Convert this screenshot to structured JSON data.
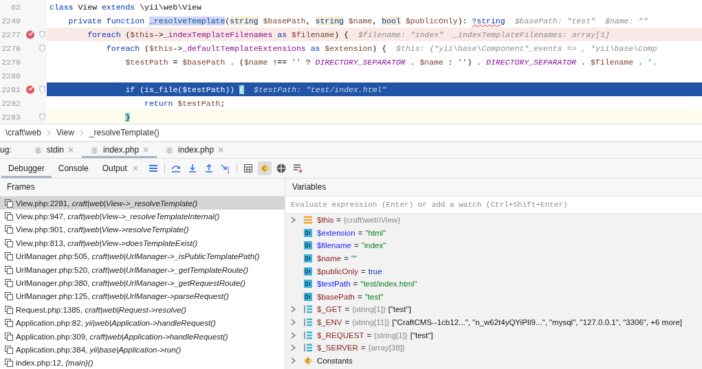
{
  "editor": {
    "lines": [
      {
        "number": "62",
        "kind": "normal",
        "breakpoint": false,
        "fold": false,
        "tokens": [
          {
            "kind": "kw",
            "text": "class"
          },
          {
            "kind": "plain",
            "text": " View "
          },
          {
            "kind": "kw",
            "text": "extends"
          },
          {
            "kind": "plain",
            "text": " \\yii\\web\\View"
          }
        ]
      },
      {
        "number": "2249",
        "kind": "normal",
        "breakpoint": false,
        "fold": false,
        "tokens": [
          {
            "kind": "kw",
            "text": "    private function "
          },
          {
            "kind": "fnhl",
            "text": "_resolveTemplate"
          },
          {
            "kind": "plain",
            "text": "("
          },
          {
            "kind": "typehl",
            "text": "string"
          },
          {
            "kind": "var",
            "text": " $basePath"
          },
          {
            "kind": "plain",
            "text": ", "
          },
          {
            "kind": "typehl",
            "text": "string"
          },
          {
            "kind": "var",
            "text": " $name"
          },
          {
            "kind": "plain",
            "text": ", "
          },
          {
            "kind": "typehl",
            "text": "bool"
          },
          {
            "kind": "var",
            "text": " $publicOnly"
          },
          {
            "kind": "plain",
            "text": "): "
          },
          {
            "kind": "err",
            "text": "?string"
          }
        ],
        "hints": [
          "$basePath: \"test\"",
          "$name: \"\""
        ]
      },
      {
        "number": "2277",
        "kind": "breakpoint",
        "breakpoint": true,
        "fold": true,
        "tokens": [
          {
            "kind": "kw",
            "text": "        foreach"
          },
          {
            "kind": "plain",
            "text": " ("
          },
          {
            "kind": "var",
            "text": "$this"
          },
          {
            "kind": "plain",
            "text": "->"
          },
          {
            "kind": "field",
            "text": "_indexTemplateFilenames"
          },
          {
            "kind": "kw",
            "text": " as "
          },
          {
            "kind": "var",
            "text": "$filename"
          },
          {
            "kind": "plain",
            "text": ") {"
          }
        ],
        "hints": [
          "$filename: \"index\"",
          "_indexTemplateFilenames: array[1]"
        ]
      },
      {
        "number": "2278",
        "kind": "normal",
        "breakpoint": false,
        "fold": true,
        "tokens": [
          {
            "kind": "kw",
            "text": "            foreach"
          },
          {
            "kind": "plain",
            "text": " ("
          },
          {
            "kind": "var",
            "text": "$this"
          },
          {
            "kind": "plain",
            "text": "->"
          },
          {
            "kind": "field",
            "text": "_defaultTemplateExtensions"
          },
          {
            "kind": "kw",
            "text": " as "
          },
          {
            "kind": "var",
            "text": "$extension"
          },
          {
            "kind": "plain",
            "text": ") {"
          }
        ],
        "hints": [
          "$this: {*yii\\base\\Component*_events => , *yii\\base\\Comp"
        ]
      },
      {
        "number": "2279",
        "kind": "normal",
        "breakpoint": false,
        "fold": false,
        "tokens": [
          {
            "kind": "var",
            "text": "                $testPath"
          },
          {
            "kind": "plain",
            "text": " = "
          },
          {
            "kind": "var",
            "text": "$basePath"
          },
          {
            "kind": "plain",
            "text": " . ("
          },
          {
            "kind": "var",
            "text": "$name"
          },
          {
            "kind": "plain",
            "text": " !== "
          },
          {
            "kind": "str",
            "text": "''"
          },
          {
            "kind": "plain",
            "text": " ? "
          },
          {
            "kind": "const",
            "text": "DIRECTORY_SEPARATOR"
          },
          {
            "kind": "plain",
            "text": " . "
          },
          {
            "kind": "var",
            "text": "$name"
          },
          {
            "kind": "plain",
            "text": " : "
          },
          {
            "kind": "str",
            "text": "''"
          },
          {
            "kind": "plain",
            "text": ") . "
          },
          {
            "kind": "const",
            "text": "DIRECTORY_SEPARATOR"
          },
          {
            "kind": "plain",
            "text": " . "
          },
          {
            "kind": "var",
            "text": "$filename"
          },
          {
            "kind": "plain",
            "text": " . "
          },
          {
            "kind": "str",
            "text": "'."
          }
        ]
      },
      {
        "number": "2280",
        "kind": "normal",
        "breakpoint": false,
        "fold": false
      },
      {
        "number": "2281",
        "kind": "execution",
        "breakpoint": true,
        "fold": true,
        "tokens": [
          {
            "kind": "kw",
            "text": "                if"
          },
          {
            "kind": "plain",
            "text": " (is_file("
          },
          {
            "kind": "var",
            "text": "$testPath"
          },
          {
            "kind": "plain",
            "text": ")) "
          },
          {
            "kind": "brace",
            "text": "{"
          }
        ],
        "hints": [
          "$testPath: \"test/index.html\""
        ]
      },
      {
        "number": "2282",
        "kind": "normal",
        "breakpoint": false,
        "fold": false,
        "tokens": [
          {
            "kind": "kw",
            "text": "                    return"
          },
          {
            "kind": "var",
            "text": " $testPath"
          },
          {
            "kind": "plain",
            "text": ";"
          }
        ]
      },
      {
        "number": "2283",
        "kind": "caret",
        "breakpoint": false,
        "fold": true,
        "tokens": [
          {
            "kind": "brace",
            "text": "                }"
          }
        ]
      }
    ]
  },
  "breadcrumb": [
    "\\craft\\web",
    "View",
    "_resolveTemplate()"
  ],
  "debug_label": "ug:",
  "sessions": [
    {
      "label": "stdin",
      "selected": false
    },
    {
      "label": "index.php",
      "selected": true
    },
    {
      "label": "index.php",
      "selected": false
    }
  ],
  "subtabs": [
    {
      "label": "Debugger",
      "selected": true,
      "closable": false
    },
    {
      "label": "Console",
      "selected": false,
      "closable": false
    },
    {
      "label": "Output",
      "selected": false,
      "closable": true
    }
  ],
  "toolbar": [
    {
      "kind": "menu",
      "pressed": false
    },
    {
      "kind": "step-over",
      "pressed": false
    },
    {
      "kind": "step-into",
      "pressed": false
    },
    {
      "kind": "step-out",
      "pressed": false
    },
    {
      "kind": "run-to-cursor",
      "pressed": false
    },
    {
      "kind": "calculator",
      "pressed": false
    },
    {
      "kind": "constant",
      "pressed": true
    },
    {
      "kind": "globe",
      "pressed": false
    },
    {
      "kind": "add-list",
      "pressed": false
    }
  ],
  "frames": {
    "title": "Frames",
    "items": [
      {
        "location": "View.php:2281, ",
        "method": "craft|web|View->_resolveTemplate()",
        "selected": true
      },
      {
        "location": "View.php:947, ",
        "method": "craft|web|View->_resolveTemplateInternal()",
        "selected": false
      },
      {
        "location": "View.php:901, ",
        "method": "craft|web|View->resolveTemplate()",
        "selected": false
      },
      {
        "location": "View.php:813, ",
        "method": "craft|web|View->doesTemplateExist()",
        "selected": false
      },
      {
        "location": "UrlManager.php:505, ",
        "method": "craft|web|UrlManager->_isPublicTemplatePath()",
        "selected": false
      },
      {
        "location": "UrlManager.php:520, ",
        "method": "craft|web|UrlManager->_getTemplateRoute()",
        "selected": false
      },
      {
        "location": "UrlManager.php:380, ",
        "method": "craft|web|UrlManager->_getRequestRoute()",
        "selected": false
      },
      {
        "location": "UrlManager.php:125, ",
        "method": "craft|web|UrlManager->parseRequest()",
        "selected": false
      },
      {
        "location": "Request.php:1385, ",
        "method": "craft|web|Request->resolve()",
        "selected": false
      },
      {
        "location": "Application.php:82, ",
        "method": "yii|web|Application->handleRequest()",
        "selected": false
      },
      {
        "location": "Application.php:309, ",
        "method": "craft|web|Application->handleRequest()",
        "selected": false
      },
      {
        "location": "Application.php:384, ",
        "method": "yii|base|Application->run()",
        "selected": false
      },
      {
        "location": "index.php:12, ",
        "method": "{main}()",
        "selected": false
      }
    ]
  },
  "variables": {
    "title": "Variables",
    "placeholder": "Evaluate expression (Enter) or add a watch (Ctrl+Shift+Enter)",
    "items": [
      {
        "kind": "object",
        "expandable": true,
        "name": "$this",
        "changed": false,
        "operator": "=",
        "type": "{craft\\web\\View}"
      },
      {
        "kind": "scalar",
        "expandable": false,
        "name": "$extension",
        "changed": true,
        "operator": "=",
        "value": {
          "kind": "string",
          "text": "\"html\""
        }
      },
      {
        "kind": "scalar",
        "expandable": false,
        "name": "$filename",
        "changed": true,
        "operator": "=",
        "value": {
          "kind": "string",
          "text": "\"index\""
        }
      },
      {
        "kind": "scalar",
        "expandable": false,
        "name": "$name",
        "changed": false,
        "operator": "=",
        "value": {
          "kind": "string",
          "text": "\"\""
        }
      },
      {
        "kind": "scalar",
        "expandable": false,
        "name": "$publicOnly",
        "changed": false,
        "operator": "=",
        "value": {
          "kind": "bool",
          "text": "true"
        }
      },
      {
        "kind": "scalar",
        "expandable": false,
        "name": "$testPath",
        "changed": true,
        "operator": "=",
        "value": {
          "kind": "string",
          "text": "\"test/index.html\""
        }
      },
      {
        "kind": "scalar",
        "expandable": false,
        "name": "$basePath",
        "changed": false,
        "operator": "=",
        "value": {
          "kind": "string",
          "text": "\"test\""
        }
      },
      {
        "kind": "array",
        "expandable": true,
        "name": "$_GET",
        "changed": false,
        "operator": "=",
        "type": "{string[1]}",
        "value": {
          "kind": "plain",
          "text": "[\"test\"]"
        }
      },
      {
        "kind": "array",
        "expandable": true,
        "name": "$_ENV",
        "changed": false,
        "operator": "=",
        "type": "{string[11]}",
        "value": {
          "kind": "plain",
          "text": "[\"CraftCMS--1cb12...\", \"n_w62t4yQYiPIl9...\", \"mysql\", \"127.0.0.1\", \"3306\", +6 more]"
        }
      },
      {
        "kind": "array",
        "expandable": true,
        "name": "$_REQUEST",
        "changed": false,
        "operator": "=",
        "type": "{string[1]}",
        "value": {
          "kind": "plain",
          "text": "[\"test\"]"
        }
      },
      {
        "kind": "array",
        "expandable": true,
        "name": "$_SERVER",
        "changed": false,
        "operator": "=",
        "type": "{array[38]}"
      },
      {
        "kind": "constant",
        "expandable": true,
        "name": "Constants"
      }
    ]
  }
}
